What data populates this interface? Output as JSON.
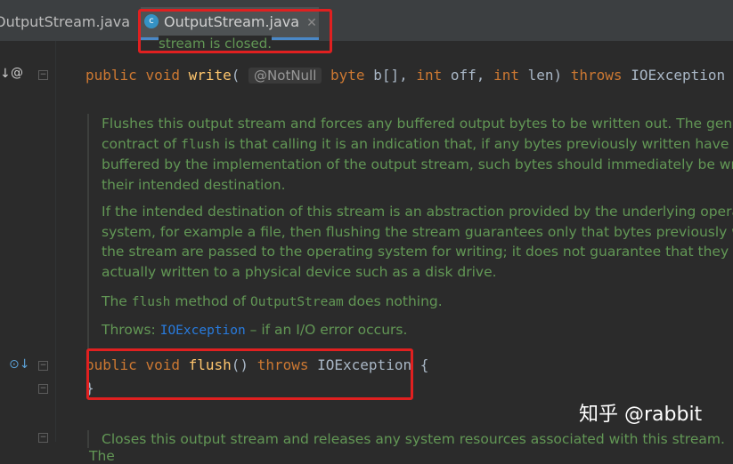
{
  "tabs": [
    {
      "label": "OutputStream.java",
      "active": false
    },
    {
      "label": "OutputStream.java",
      "active": true
    }
  ],
  "doc_tail": "stream is closed.",
  "write_sig": {
    "kw1": "public",
    "kw2": "void",
    "name": "write",
    "annotation": "@NotNull",
    "rest": "byte b[], int off, int len)",
    "throws": "throws",
    "exc": "IOException"
  },
  "doc": {
    "p1": [
      "Flushes this output stream and forces any buffered output bytes to be written out. The gener",
      "contract of ",
      "flush",
      " is that calling it is an indication that, if any bytes previously written have be",
      "buffered by the implementation of the output stream, such bytes should immediately be writ",
      "their intended destination."
    ],
    "p2": [
      "If the intended destination of this stream is an abstraction provided by the underlying operat",
      "system, for example a file, then flushing the stream guarantees only that bytes previously writ",
      "the stream are passed to the operating system for writing; it does not guarantee that they are",
      "actually written to a physical device such as a disk drive."
    ],
    "p3": [
      "The ",
      "flush",
      " method of ",
      "OutputStream",
      " does nothing."
    ],
    "throws_label": "Throws: ",
    "throws_link": "IOException",
    "throws_text": " – if an I/O error occurs."
  },
  "flush_sig": {
    "kw1": "public",
    "kw2": "void",
    "name": "flush",
    "rest": "() ",
    "throws": "throws",
    "exc": "IOException {"
  },
  "closing_brace": "}",
  "bottom_doc": "Closes this output stream and releases any system resources associated with this stream. The",
  "watermark": "知乎 @rabbit",
  "icons": {
    "file": "java-class-icon",
    "override": "override-icon",
    "implemented": "implemented-icon"
  }
}
